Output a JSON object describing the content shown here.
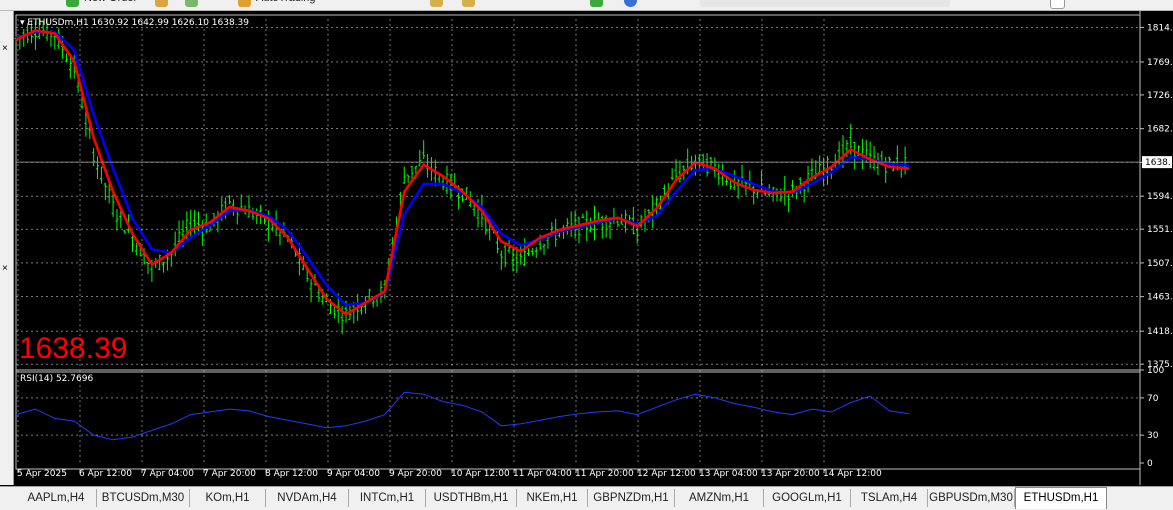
{
  "toolbar": {
    "new_order_label": "New Order",
    "algo_trading_label": "AutoTrading"
  },
  "chart": {
    "symbol_header": "ETHUSDm,H1",
    "ohlc_text": "1630.92 1642.99 1626.10 1638.39",
    "big_price": "1638.39",
    "current_price_tag": "1638.",
    "colors": {
      "background": "#000000",
      "grid": "#c0c0c0",
      "candles": "#00ff00",
      "ma_fast": "#ff0000",
      "ma_slow": "#0000ff",
      "rsi_line": "#1e3cff",
      "big_price": "#ff0000",
      "current_price_line": "#808080"
    }
  },
  "rsi": {
    "label": "RSI(14) 52.7696",
    "ticks": [
      "100",
      "70",
      "30",
      "0"
    ]
  },
  "chart_data": {
    "type": "candlestick",
    "symbol": "ETHUSDm",
    "timeframe": "H1",
    "y_ticks": [
      "1814.",
      "1769.",
      "1726.",
      "1682.",
      "1638.",
      "1594.",
      "1551.",
      "1507.",
      "1463.",
      "1418.",
      "1375."
    ],
    "ylim": [
      1370,
      1825
    ],
    "x_ticks": [
      "5 Apr 2025",
      "6 Apr 12:00",
      "7 Apr 04:00",
      "7 Apr 20:00",
      "8 Apr 12:00",
      "9 Apr 04:00",
      "9 Apr 20:00",
      "10 Apr 12:00",
      "11 Apr 04:00",
      "11 Apr 20:00",
      "12 Apr 12:00",
      "13 Apr 04:00",
      "13 Apr 20:00",
      "14 Apr 12:00"
    ],
    "price_series": [
      1800,
      1812,
      1805,
      1760,
      1650,
      1580,
      1540,
      1500,
      1520,
      1560,
      1555,
      1585,
      1575,
      1560,
      1540,
      1490,
      1455,
      1440,
      1460,
      1470,
      1620,
      1640,
      1615,
      1600,
      1570,
      1520,
      1510,
      1535,
      1548,
      1555,
      1560,
      1565,
      1552,
      1580,
      1620,
      1640,
      1632,
      1610,
      1605,
      1595,
      1600,
      1620,
      1635,
      1660,
      1642,
      1635,
      1638
    ],
    "ma_fast": [
      1798,
      1810,
      1806,
      1770,
      1670,
      1600,
      1545,
      1505,
      1520,
      1550,
      1560,
      1580,
      1575,
      1565,
      1540,
      1500,
      1460,
      1440,
      1455,
      1470,
      1600,
      1635,
      1620,
      1600,
      1575,
      1535,
      1522,
      1540,
      1550,
      1556,
      1562,
      1566,
      1555,
      1578,
      1615,
      1638,
      1630,
      1612,
      1602,
      1598,
      1600,
      1618,
      1632,
      1655,
      1642,
      1632,
      1630
    ],
    "ma_slow": [
      1800,
      1808,
      1808,
      1785,
      1700,
      1630,
      1565,
      1525,
      1520,
      1540,
      1556,
      1575,
      1576,
      1568,
      1550,
      1515,
      1478,
      1452,
      1455,
      1468,
      1570,
      1610,
      1610,
      1598,
      1580,
      1545,
      1530,
      1538,
      1548,
      1554,
      1560,
      1565,
      1558,
      1568,
      1600,
      1628,
      1630,
      1620,
      1610,
      1600,
      1598,
      1610,
      1625,
      1645,
      1642,
      1636,
      1634
    ],
    "rsi_values": [
      52,
      58,
      48,
      45,
      30,
      25,
      28,
      35,
      42,
      52,
      55,
      58,
      56,
      50,
      46,
      42,
      38,
      40,
      45,
      52,
      76,
      74,
      66,
      62,
      55,
      40,
      42,
      46,
      50,
      53,
      55,
      56,
      52,
      60,
      68,
      74,
      70,
      64,
      60,
      55,
      52,
      58,
      55,
      65,
      72,
      56,
      53
    ],
    "current_price": 1638.39,
    "rsi_ylim": [
      0,
      100
    ]
  },
  "tabs": [
    "AAPLm,H4",
    "BTCUSDm,M30",
    "KOm,H1",
    "NVDAm,H4",
    "INTCm,H1",
    "USDTHBm,H1",
    "NKEm,H1",
    "GBPNZDm,H1",
    "AMZNm,H1",
    "GOOGLm,H1",
    "TSLAm,H4",
    "GBPUSDm,M30",
    "ETHUSDm,H1"
  ],
  "left_markers": [
    "×",
    "×"
  ]
}
